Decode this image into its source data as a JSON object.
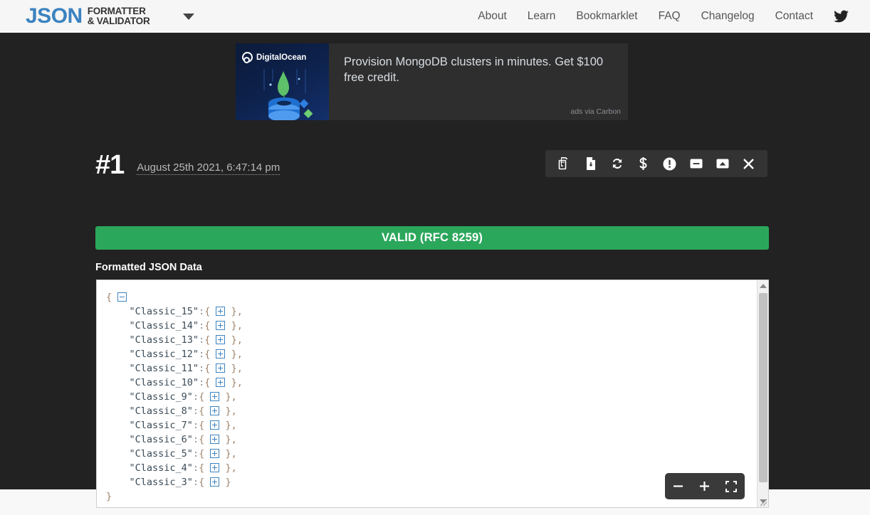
{
  "header": {
    "logo_main": "JSON",
    "logo_sub_line1": "FORMATTER",
    "logo_sub_line2": "& VALIDATOR",
    "dropdown_icon": "caret-down-icon",
    "nav": [
      {
        "label": "About"
      },
      {
        "label": "Learn"
      },
      {
        "label": "Bookmarklet"
      },
      {
        "label": "FAQ"
      },
      {
        "label": "Changelog"
      },
      {
        "label": "Contact"
      }
    ],
    "social_icon": "twitter-icon"
  },
  "ad": {
    "advertiser": "DigitalOcean",
    "headline": "Provision MongoDB clusters in minutes. Get $100 free credit.",
    "attribution": "ads via Carbon"
  },
  "result": {
    "number": "#1",
    "timestamp": "August 25th 2021, 6:47:14 pm",
    "status_text": "VALID (RFC 8259)",
    "status_color": "#2ba75c",
    "section_label": "Formatted JSON Data"
  },
  "toolbar": {
    "buttons": [
      {
        "name": "copy-icon",
        "title": "Copy"
      },
      {
        "name": "download-file-icon",
        "title": "Download"
      },
      {
        "name": "refresh-icon",
        "title": "Refresh"
      },
      {
        "name": "dollar-icon",
        "title": "Donate"
      },
      {
        "name": "alert-circle-icon",
        "title": "Report"
      },
      {
        "name": "minus-square-icon",
        "title": "Collapse"
      },
      {
        "name": "image-icon",
        "title": "Image"
      },
      {
        "name": "close-icon",
        "title": "Close"
      }
    ]
  },
  "editor": {
    "root_open": "{",
    "root_close": "}",
    "root_toggle": "minus",
    "entries": [
      {
        "key": "\"Classic_15\"",
        "value": "{  }",
        "comma": ","
      },
      {
        "key": "\"Classic_14\"",
        "value": "{  }",
        "comma": ","
      },
      {
        "key": "\"Classic_13\"",
        "value": "{  }",
        "comma": ","
      },
      {
        "key": "\"Classic_12\"",
        "value": "{  }",
        "comma": ","
      },
      {
        "key": "\"Classic_11\"",
        "value": "{  }",
        "comma": ","
      },
      {
        "key": "\"Classic_10\"",
        "value": "{  }",
        "comma": ","
      },
      {
        "key": "\"Classic_9\"",
        "value": "{  }",
        "comma": ","
      },
      {
        "key": "\"Classic_8\"",
        "value": "{  }",
        "comma": ","
      },
      {
        "key": "\"Classic_7\"",
        "value": "{  }",
        "comma": ","
      },
      {
        "key": "\"Classic_6\"",
        "value": "{  }",
        "comma": ","
      },
      {
        "key": "\"Classic_5\"",
        "value": "{  }",
        "comma": ","
      },
      {
        "key": "\"Classic_4\"",
        "value": "{  }",
        "comma": ","
      },
      {
        "key": "\"Classic_3\"",
        "value": "{  }",
        "comma": ""
      }
    ],
    "scrollbar": {
      "up_icon": "scroll-up-arrow-icon",
      "down_icon": "scroll-down-arrow-icon"
    },
    "zoom_controls": {
      "zoom_out_icon": "minus-icon",
      "zoom_in_icon": "plus-icon",
      "fullscreen_icon": "fullscreen-icon"
    }
  }
}
